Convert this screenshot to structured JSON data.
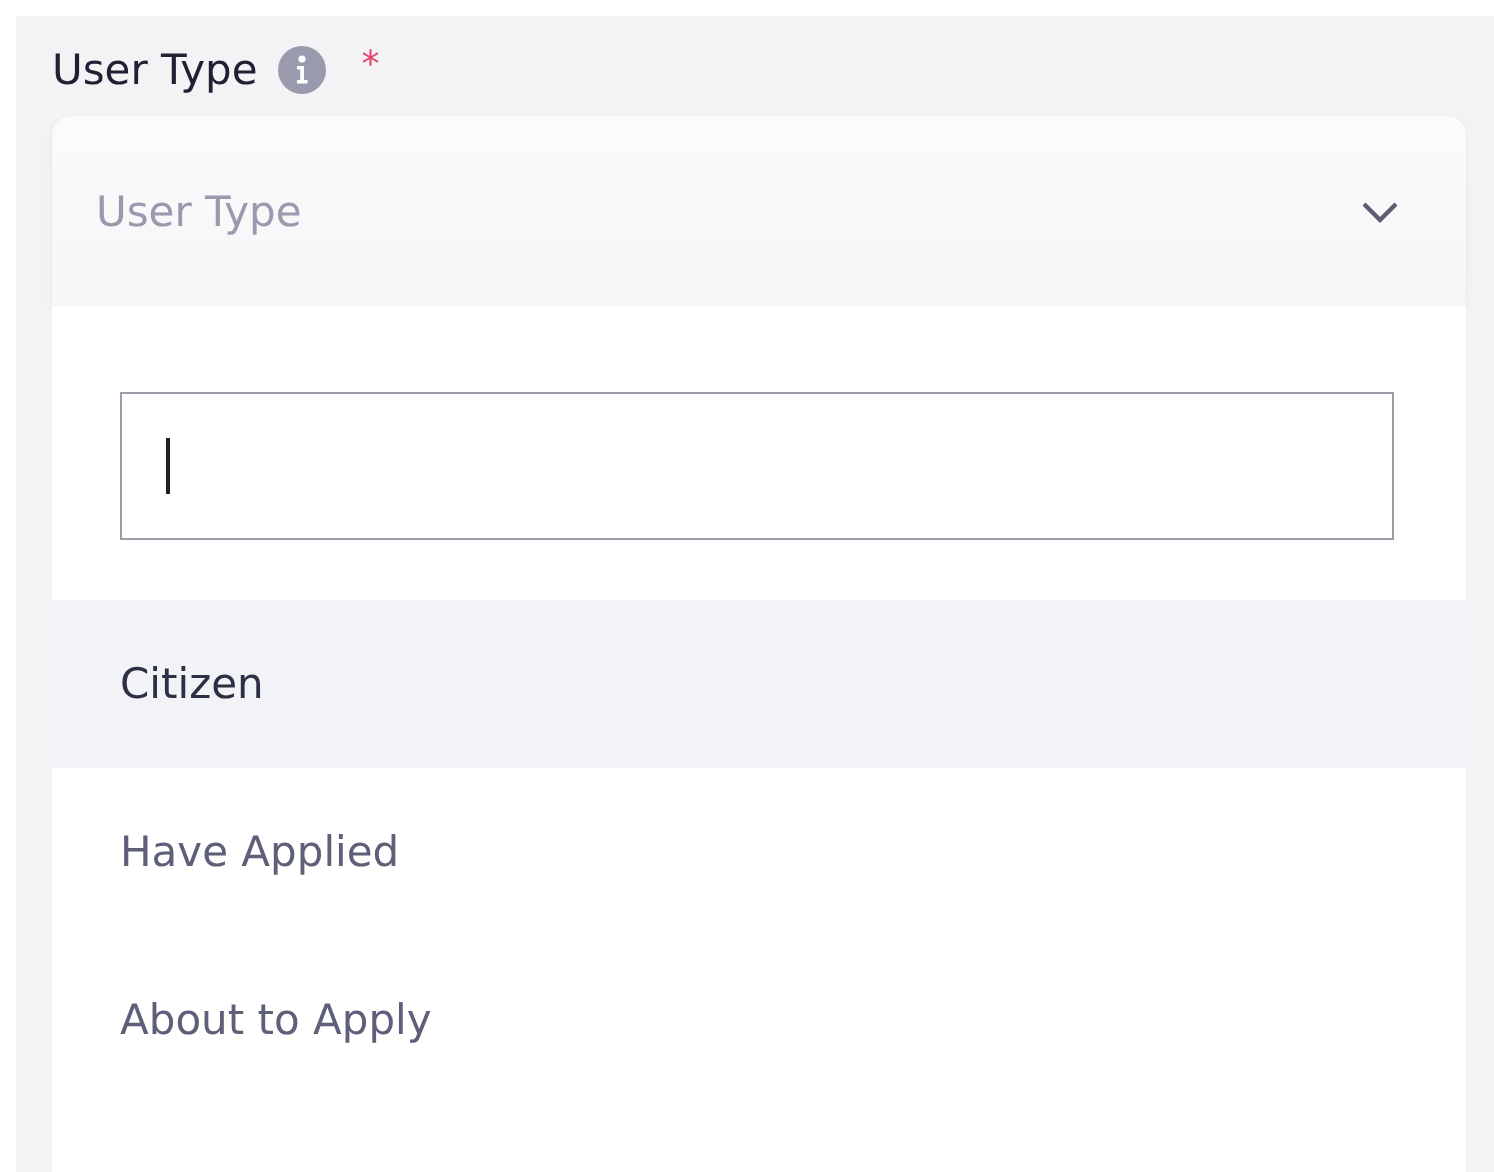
{
  "field": {
    "label": "User Type",
    "required_mark": "*",
    "placeholder": "User Type",
    "expanded": true
  },
  "search": {
    "focused": true
  },
  "options": [
    {
      "label": "Citizen",
      "selected": true
    },
    {
      "label": "Have Applied",
      "selected": false
    },
    {
      "label": "About to Apply",
      "selected": false
    }
  ]
}
